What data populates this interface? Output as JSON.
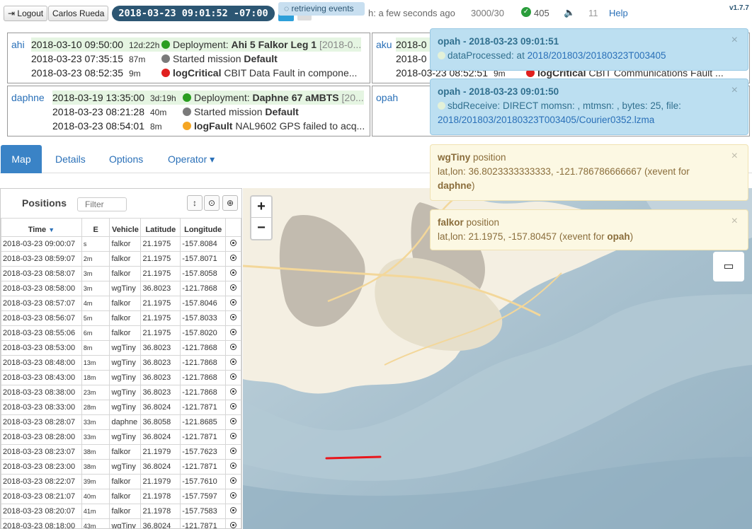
{
  "topbar": {
    "logout_label": "Logout",
    "user_label": "Carlos Rueda",
    "datetime": "2018-03-23 09:01:52 -07:00",
    "retrieving_label": "retrieving events",
    "refresh_label": "h: a few seconds ago",
    "counts": "3000/30",
    "ok_count": "405",
    "eleven": "11",
    "help_label": "Help",
    "version": "v1.7.7"
  },
  "cards": [
    {
      "name": "ahi",
      "rows": [
        {
          "ts": "2018-03-10 09:50:00",
          "dur": "12d:22h",
          "dot": "green",
          "pre": "Deployment: ",
          "bold": "Ahi 5 Falkor Leg 1",
          "post": " [2018-0..."
        },
        {
          "ts": "2018-03-23 07:35:15",
          "dur": "87m",
          "dot": "grey",
          "pre": "Started mission ",
          "bold": "Default",
          "post": ""
        },
        {
          "ts": "2018-03-23 08:52:35",
          "dur": "9m",
          "dot": "red",
          "pre": "",
          "bold": "logCritical",
          "post": " CBIT Data Fault in compone..."
        }
      ]
    },
    {
      "name": "aku",
      "rows": [
        {
          "ts": "2018-0",
          "dur": "",
          "dot": "",
          "pre": "",
          "bold": "",
          "post": ""
        },
        {
          "ts": "2018-0",
          "dur": "",
          "dot": "",
          "pre": "",
          "bold": "",
          "post": ""
        },
        {
          "ts": "2018-03-23 08:52:51",
          "dur": "9m",
          "dot": "red",
          "pre": "",
          "bold": "logCritical",
          "post": " CBIT Communications Fault ..."
        }
      ]
    },
    {
      "name": "daphne",
      "rows": [
        {
          "ts": "2018-03-19 13:35:00",
          "dur": "3d:19h",
          "dot": "green",
          "pre": "Deployment: ",
          "bold": "Daphne 67 aMBTS",
          "post": " [20..."
        },
        {
          "ts": "2018-03-23 08:21:28",
          "dur": "40m",
          "dot": "grey",
          "pre": "Started mission ",
          "bold": "Default",
          "post": ""
        },
        {
          "ts": "2018-03-23 08:54:01",
          "dur": "8m",
          "dot": "orange",
          "pre": "",
          "bold": "logFault",
          "post": " NAL9602 GPS failed to acq..."
        }
      ]
    },
    {
      "name": "opah",
      "rows": []
    }
  ],
  "tabs": [
    {
      "label": "Map"
    },
    {
      "label": "Details"
    },
    {
      "label": "Options"
    },
    {
      "label": "Operator ▾"
    }
  ],
  "positions": {
    "title": "Positions",
    "filter_placeholder": "Filter",
    "columns": [
      "Time",
      "E",
      "Vehicle",
      "Latitude",
      "Longitude"
    ],
    "rows": [
      [
        "2018-03-23 09:00:07",
        "s",
        "falkor",
        "21.1975",
        "-157.8084"
      ],
      [
        "2018-03-23 08:59:07",
        "2m",
        "falkor",
        "21.1975",
        "-157.8071"
      ],
      [
        "2018-03-23 08:58:07",
        "3m",
        "falkor",
        "21.1975",
        "-157.8058"
      ],
      [
        "2018-03-23 08:58:00",
        "3m",
        "wgTiny",
        "36.8023",
        "-121.7868"
      ],
      [
        "2018-03-23 08:57:07",
        "4m",
        "falkor",
        "21.1975",
        "-157.8046"
      ],
      [
        "2018-03-23 08:56:07",
        "5m",
        "falkor",
        "21.1975",
        "-157.8033"
      ],
      [
        "2018-03-23 08:55:06",
        "6m",
        "falkor",
        "21.1975",
        "-157.8020"
      ],
      [
        "2018-03-23 08:53:00",
        "8m",
        "wgTiny",
        "36.8023",
        "-121.7868"
      ],
      [
        "2018-03-23 08:48:00",
        "13m",
        "wgTiny",
        "36.8023",
        "-121.7868"
      ],
      [
        "2018-03-23 08:43:00",
        "18m",
        "wgTiny",
        "36.8023",
        "-121.7868"
      ],
      [
        "2018-03-23 08:38:00",
        "23m",
        "wgTiny",
        "36.8023",
        "-121.7868"
      ],
      [
        "2018-03-23 08:33:00",
        "28m",
        "wgTiny",
        "36.8024",
        "-121.7871"
      ],
      [
        "2018-03-23 08:28:07",
        "33m",
        "daphne",
        "36.8058",
        "-121.8685"
      ],
      [
        "2018-03-23 08:28:00",
        "33m",
        "wgTiny",
        "36.8024",
        "-121.7871"
      ],
      [
        "2018-03-23 08:23:07",
        "38m",
        "falkor",
        "21.1979",
        "-157.7623"
      ],
      [
        "2018-03-23 08:23:00",
        "38m",
        "wgTiny",
        "36.8024",
        "-121.7871"
      ],
      [
        "2018-03-23 08:22:07",
        "39m",
        "falkor",
        "21.1979",
        "-157.7610"
      ],
      [
        "2018-03-23 08:21:07",
        "40m",
        "falkor",
        "21.1978",
        "-157.7597"
      ],
      [
        "2018-03-23 08:20:07",
        "41m",
        "falkor",
        "21.1978",
        "-157.7583"
      ],
      [
        "2018-03-23 08:18:00",
        "43m",
        "wgTiny",
        "36.8024",
        "-121.7871"
      ]
    ]
  },
  "notifications": [
    {
      "type": "info",
      "title": "opah - 2018-03-23 09:01:51",
      "line1_pre": "dataProcessed: at ",
      "line1_link": "2018/201803/20180323T003405",
      "line2": ""
    },
    {
      "type": "info",
      "title": "opah - 2018-03-23 09:01:50",
      "line1_pre": "sbdReceive: DIRECT momsn: , mtmsn: , bytes: 25, file:",
      "line1_link": "",
      "line2": "2018/201803/20180323T003405/Courier0352.lzma"
    },
    {
      "type": "warn",
      "title_bold": "wgTiny",
      "title_rest": " position",
      "body": "lat,lon: 36.8023333333333, -121.786786666667 (xevent for",
      "body_bold": "daphne",
      "body_end": ")"
    },
    {
      "type": "warn",
      "title_bold": "falkor",
      "title_rest": " position",
      "body": "lat,lon: 21.1975, -157.80457 (xevent for ",
      "body_bold": "opah",
      "body_end": ")"
    }
  ],
  "map": {
    "zoom_in": "+",
    "zoom_out": "−",
    "track_color": "#e8161c",
    "ocean_color": "#9fb8c8",
    "land_color": "#f4efe2"
  }
}
